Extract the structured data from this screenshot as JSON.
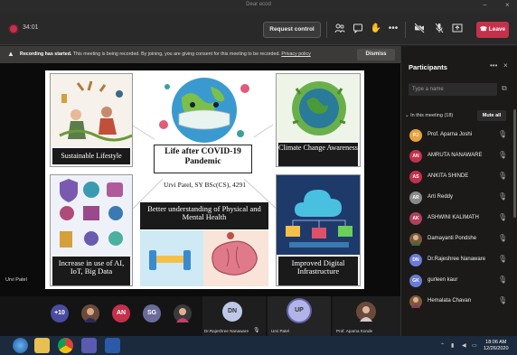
{
  "window": {
    "title": "Dear ecod"
  },
  "toolbar": {
    "timer": "34:01",
    "request_control": "Request control",
    "leave": "Leave",
    "icons": [
      "participants-icon",
      "chat-icon",
      "raise-hand-icon",
      "more-icon",
      "camera-off-icon",
      "mic-off-icon",
      "share-icon",
      "phone-icon"
    ]
  },
  "banner": {
    "bold": "Recording has started.",
    "text": "This meeting is being recorded. By joining, you are giving consent for this meeting to be recorded.",
    "link": "Privacy policy",
    "dismiss": "Dismiss"
  },
  "stage": {
    "presenter_name": "Urvi Patel",
    "slide": {
      "center_title": "Life after COVID-19 Pandemic",
      "author": "Urvi Patel, SY BSc(CS), 4291",
      "captions": {
        "sustainable": "Sustainable Lifestyle",
        "climate": "Climate Change Awareness",
        "health": "Better understanding of Physical and Mental Health",
        "tech": "Increase in use of AI, IoT, Big Data",
        "digital": "Improved Digital Infrastructure"
      }
    }
  },
  "strip": {
    "overflow": "+10",
    "avatars": [
      {
        "initials": "AN",
        "color": "#c4314b"
      },
      {
        "initials": "SG",
        "color": "#6b6b9a"
      }
    ],
    "tiles": [
      {
        "initials": "DN",
        "name": "Dr.Rajeshree Nanaware"
      },
      {
        "initials": "UP",
        "name": "Urvi Patel"
      },
      {
        "initials": "",
        "name": "Prof. Aparna Konde"
      }
    ]
  },
  "panel": {
    "title": "Participants",
    "search_placeholder": "Type a name",
    "in_meeting": "In this meeting (18)",
    "mute_all": "Mute all",
    "people": [
      {
        "initials": "PJ",
        "name": "Prof. Aparna Joshi",
        "color": "#e8a33d"
      },
      {
        "initials": "AN",
        "name": "AMRUTA NANAWARE",
        "color": "#c4314b"
      },
      {
        "initials": "AS",
        "name": "ANKITA SHINDE",
        "color": "#c4314b"
      },
      {
        "initials": "AR",
        "name": "Arti Reddy",
        "color": "#8a8a8a"
      },
      {
        "initials": "AK",
        "name": "ASHWINI KALIMATH",
        "color": "#b0405e"
      },
      {
        "initials": "",
        "name": "Damayanti Pondshe",
        "color": "#7a5a3a"
      },
      {
        "initials": "DN",
        "name": "Dr.Rajeshree Nanaware",
        "color": "#6b7bd6"
      },
      {
        "initials": "GK",
        "name": "gurleen kaur",
        "color": "#6b7bd6"
      },
      {
        "initials": "",
        "name": "Hemalata Chavan",
        "color": "#7a5a3a"
      }
    ]
  },
  "taskbar": {
    "time": "18:06 AM",
    "date": "12/26/2020"
  },
  "colors": {
    "leave": "#c4314b",
    "accent": "#6264a7",
    "taskbar": "#1c2a3d"
  }
}
